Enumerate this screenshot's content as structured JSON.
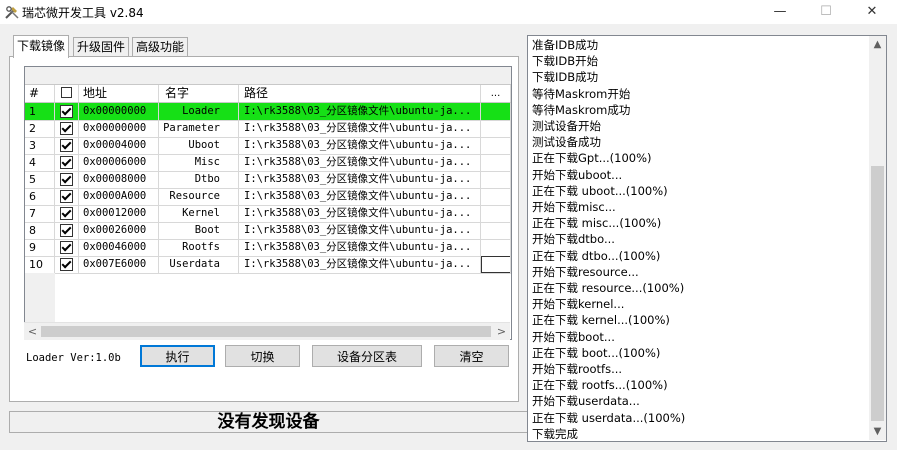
{
  "window": {
    "title": "瑞芯微开发工具 v2.84",
    "min": "—",
    "max": "☐",
    "close": "✕"
  },
  "tabs": [
    {
      "label": "下载镜像"
    },
    {
      "label": "升级固件"
    },
    {
      "label": "高级功能"
    }
  ],
  "grid": {
    "headers": {
      "num": "#",
      "addr": "地址",
      "name": "名字",
      "path": "路径",
      "dots": "..."
    },
    "rows": [
      {
        "num": "1",
        "addr": "0x00000000",
        "name": "Loader",
        "path": "I:\\rk3588\\03_分区镜像文件\\ubuntu-ja...",
        "checked": true
      },
      {
        "num": "2",
        "addr": "0x00000000",
        "name": "Parameter",
        "path": "I:\\rk3588\\03_分区镜像文件\\ubuntu-ja...",
        "checked": true
      },
      {
        "num": "3",
        "addr": "0x00004000",
        "name": "Uboot",
        "path": "I:\\rk3588\\03_分区镜像文件\\ubuntu-ja...",
        "checked": true
      },
      {
        "num": "4",
        "addr": "0x00006000",
        "name": "Misc",
        "path": "I:\\rk3588\\03_分区镜像文件\\ubuntu-ja...",
        "checked": true
      },
      {
        "num": "5",
        "addr": "0x00008000",
        "name": "Dtbo",
        "path": "I:\\rk3588\\03_分区镜像文件\\ubuntu-ja...",
        "checked": true
      },
      {
        "num": "6",
        "addr": "0x0000A000",
        "name": "Resource",
        "path": "I:\\rk3588\\03_分区镜像文件\\ubuntu-ja...",
        "checked": true
      },
      {
        "num": "7",
        "addr": "0x00012000",
        "name": "Kernel",
        "path": "I:\\rk3588\\03_分区镜像文件\\ubuntu-ja...",
        "checked": true
      },
      {
        "num": "8",
        "addr": "0x00026000",
        "name": "Boot",
        "path": "I:\\rk3588\\03_分区镜像文件\\ubuntu-ja...",
        "checked": true
      },
      {
        "num": "9",
        "addr": "0x00046000",
        "name": "Rootfs",
        "path": "I:\\rk3588\\03_分区镜像文件\\ubuntu-ja...",
        "checked": true
      },
      {
        "num": "10",
        "addr": "0x007E6000",
        "name": "Userdata",
        "path": "I:\\rk3588\\03_分区镜像文件\\ubuntu-ja...",
        "checked": true
      }
    ]
  },
  "loader_version": "Loader Ver:1.0b",
  "buttons": {
    "execute": "执行",
    "switch": "切换",
    "partition": "设备分区表",
    "clear": "清空"
  },
  "status": "没有发现设备",
  "log": [
    "准备IDB成功",
    "下载IDB开始",
    "下载IDB成功",
    "等待Maskrom开始",
    "等待Maskrom成功",
    "测试设备开始",
    "测试设备成功",
    "正在下载Gpt...(100%)",
    "开始下载uboot...",
    "正在下载 uboot...(100%)",
    "开始下载misc...",
    "正在下载 misc...(100%)",
    "开始下载dtbo...",
    "正在下载 dtbo...(100%)",
    "开始下载resource...",
    "正在下载 resource...(100%)",
    "开始下载kernel...",
    "正在下载 kernel...(100%)",
    "开始下载boot...",
    "正在下载 boot...(100%)",
    "开始下载rootfs...",
    "正在下载 rootfs...(100%)",
    "开始下载userdata...",
    "正在下载 userdata...(100%)",
    "下载完成"
  ]
}
